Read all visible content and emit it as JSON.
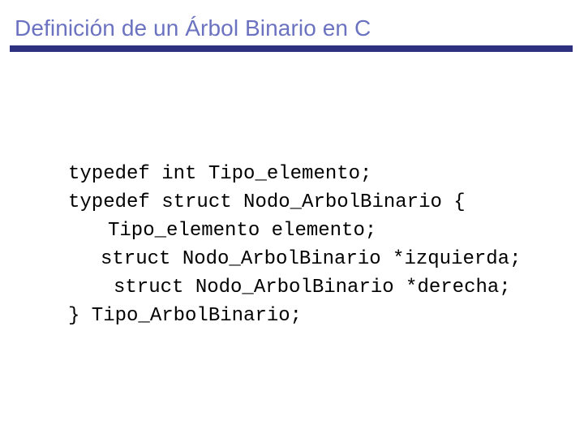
{
  "slide": {
    "background_color": "#FFFFFF",
    "title": "Definición de un Árbol Binario en C",
    "title_color": "#6B72C0",
    "rule_color": "#2E3180",
    "code_color": "#000000"
  },
  "code": {
    "language": "C",
    "lines": [
      {
        "text": "typedef int Tipo_elemento;",
        "indent_class": "ind-0"
      },
      {
        "text": "typedef struct Nodo_ArbolBinario {",
        "indent_class": "ind-0"
      },
      {
        "text": "Tipo_elemento elemento;",
        "indent_class": "ind-1"
      },
      {
        "text": "struct Nodo_ArbolBinario *izquierda;",
        "indent_class": "ind-2"
      },
      {
        "text": "struct Nodo_ArbolBinario *derecha;",
        "indent_class": "ind-3"
      },
      {
        "text": "} Tipo_ArbolBinario;",
        "indent_class": "ind-0"
      }
    ]
  }
}
